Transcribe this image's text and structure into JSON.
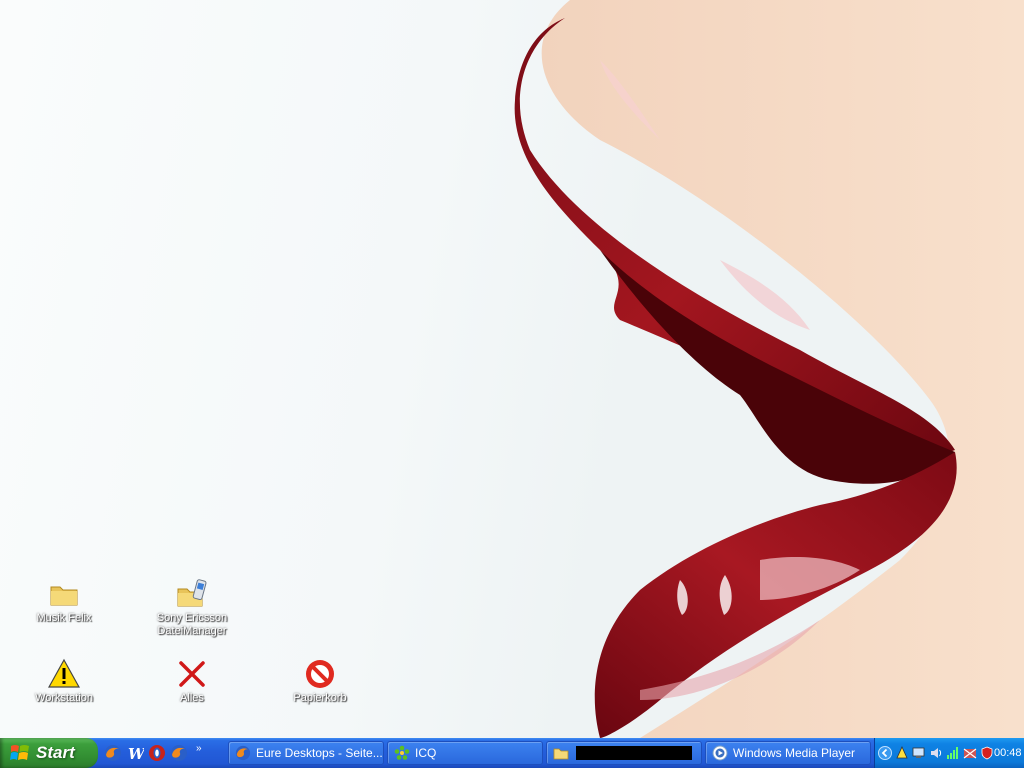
{
  "desktop": {
    "icons": [
      {
        "label": "Musik Felix",
        "icon": "folder-icon"
      },
      {
        "label": "Sony Ericsson\nDateiManager",
        "icon": "phone-folder-icon"
      },
      {
        "label": "Workstation",
        "icon": "warning-icon"
      },
      {
        "label": "Alles",
        "icon": "red-x-icon"
      },
      {
        "label": "Papierkorb",
        "icon": "no-entry-icon"
      }
    ]
  },
  "taskbar": {
    "start_label": "Start",
    "quick_launch": [
      "firefox-icon",
      "word-icon",
      "opera-icon",
      "firefox-icon"
    ],
    "tasks": [
      {
        "label": "Eure Desktops - Seite...",
        "icon": "firefox-icon"
      },
      {
        "label": "ICQ",
        "icon": "icq-flower-icon"
      },
      {
        "label": "",
        "icon": "folder-icon"
      },
      {
        "label": "Windows Media Player",
        "icon": "media-player-icon"
      }
    ],
    "tray": {
      "icons": [
        "chevron-left-icon",
        "network-icon",
        "monitor-icon",
        "volume-icon",
        "signal-icon",
        "firewall-icon",
        "shield-icon"
      ],
      "clock": "00:48"
    }
  },
  "colors": {
    "taskbar_blue": "#245edb",
    "start_green": "#3c9f3c",
    "tray_blue": "#0c79d9",
    "lip_red": "#a0141e"
  }
}
